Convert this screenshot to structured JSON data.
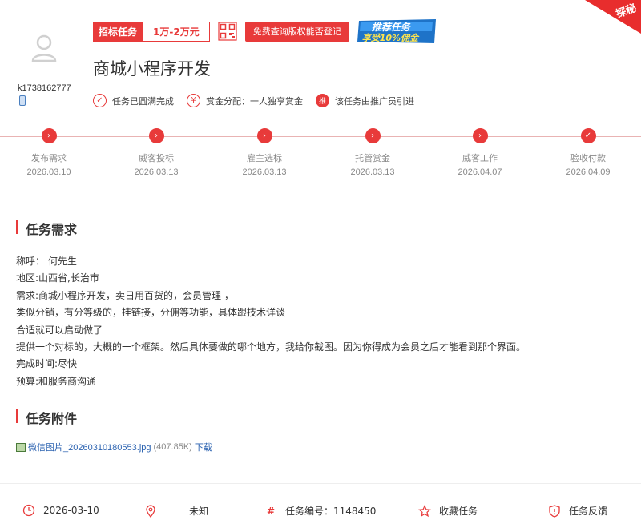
{
  "corner": {
    "label": "探秘"
  },
  "user": {
    "name": "k1738162777"
  },
  "header": {
    "task_type": "招标任务",
    "price": "1万-2万元",
    "copyright_button": "免费查询版权能否登记",
    "promo_line1": "推荐任务",
    "promo_line2": "享受10%佣金",
    "title": "商城小程序开发"
  },
  "features": [
    {
      "icon": "✓",
      "text": "任务已圆满完成"
    },
    {
      "icon": "¥",
      "text": "赏金分配：一人独享赏金"
    },
    {
      "icon": "推",
      "text": "该任务由推广员引进"
    }
  ],
  "timeline": [
    {
      "label": "发布需求",
      "date": "2026.03.10",
      "icon": "›"
    },
    {
      "label": "威客投标",
      "date": "2026.03.13",
      "icon": "›"
    },
    {
      "label": "雇主选标",
      "date": "2026.03.13",
      "icon": "›"
    },
    {
      "label": "托管赏金",
      "date": "2026.03.13",
      "icon": "›"
    },
    {
      "label": "威客工作",
      "date": "2026.04.07",
      "icon": "›"
    },
    {
      "label": "验收付款",
      "date": "2026.04.09",
      "icon": "✓"
    }
  ],
  "requirements": {
    "title": "任务需求",
    "lines": [
      "称呼： 何先生",
      "地区:山西省,长治市",
      "需求:商城小程序开发，卖日用百货的，会员管理 ，",
      "类似分销，有分等级的，挂链接，分佣等功能，具体跟技术详谈",
      "合适就可以启动做了",
      "提供一个对标的，大概的一个框架。然后具体要做的哪个地方，我给你截图。因为你得成为会员之后才能看到那个界面。",
      "完成时间:尽快",
      "预算:和服务商沟通"
    ]
  },
  "attachments": {
    "title": "任务附件",
    "file_name": "微信图片_20260310180553.jpg",
    "file_size": "(407.85K)",
    "download": "下载"
  },
  "footer": {
    "date": "2026-03-10",
    "location": "未知",
    "task_number": "任务编号：1148450",
    "favorite": "收藏任务",
    "feedback": "任务反馈"
  },
  "colors": {
    "accent": "#e83a3a",
    "link": "#2b62b0"
  }
}
